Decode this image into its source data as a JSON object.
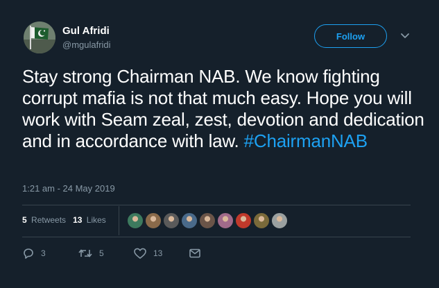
{
  "author": {
    "name": "Gul Afridi",
    "handle": "@mgulafridi",
    "avatar_icon": "pakistan-flag-avatar"
  },
  "follow_label": "Follow",
  "menu_icon": "chevron-down-icon",
  "tweet": {
    "text": "Stay strong Chairman NAB. We know fighting corrupt mafia is not that much easy. Hope you will work with Seam zeal, zest, devotion and dedication and in accordance with law.",
    "hashtag": "#ChairmanNAB",
    "timestamp": "1:21 am - 24 May 2019"
  },
  "stats": {
    "retweets_count": "5",
    "retweets_label": "Retweets",
    "likes_count": "13",
    "likes_label": "Likes"
  },
  "likers": [
    {
      "name": "liker-avatar-1",
      "color": "#3d7a5e"
    },
    {
      "name": "liker-avatar-2",
      "color": "#8a6a4a"
    },
    {
      "name": "liker-avatar-3",
      "color": "#5a5a5a"
    },
    {
      "name": "liker-avatar-4",
      "color": "#4a6a8a"
    },
    {
      "name": "liker-avatar-5",
      "color": "#6a5448"
    },
    {
      "name": "liker-avatar-6",
      "color": "#a06a8a"
    },
    {
      "name": "liker-avatar-7",
      "color": "#c0392b"
    },
    {
      "name": "liker-avatar-8",
      "color": "#7a6a3a"
    },
    {
      "name": "liker-avatar-9",
      "color": "#9aa0a0"
    }
  ],
  "actions": {
    "reply_count": "3",
    "retweet_count": "5",
    "like_count": "13"
  },
  "colors": {
    "background": "#15202b",
    "accent": "#1da1f2",
    "muted": "#8899a6",
    "divider": "#38444d"
  }
}
